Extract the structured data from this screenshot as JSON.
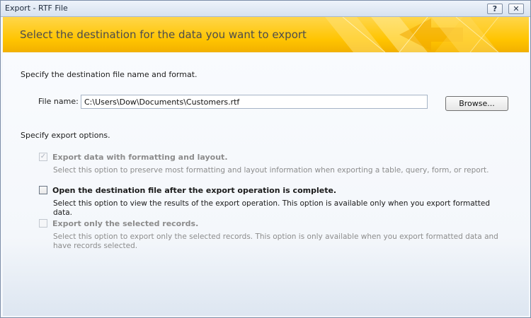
{
  "window": {
    "title": "Export - RTF File",
    "help_glyph": "?",
    "close_glyph": "✕"
  },
  "banner": {
    "heading": "Select the destination for the data you want to export"
  },
  "destination": {
    "intro": "Specify the destination file name and format.",
    "file_name_label": "File name:",
    "file_name_value": "C:\\Users\\Dow\\Documents\\Customers.rtf",
    "browse_label": "Browse..."
  },
  "options": {
    "intro": "Specify export options.",
    "items": [
      {
        "label": "Export data with formatting and layout.",
        "description": "Select this option to preserve most formatting and layout information when exporting a table, query, form, or report.",
        "checked": true,
        "enabled": false
      },
      {
        "label": "Open the destination file after the export operation is complete.",
        "description": "Select this option to view the results of the export operation. This option is available only when you export formatted data.",
        "checked": false,
        "enabled": true
      },
      {
        "label": "Export only the selected records.",
        "description": "Select this option to export only the selected records. This option is only available when you export formatted data and have records selected.",
        "checked": false,
        "enabled": false
      }
    ]
  },
  "colors": {
    "banner_yellow": "#ffc400",
    "banner_text": "#4c4c4c",
    "disabled_text": "#8c8c8c"
  }
}
